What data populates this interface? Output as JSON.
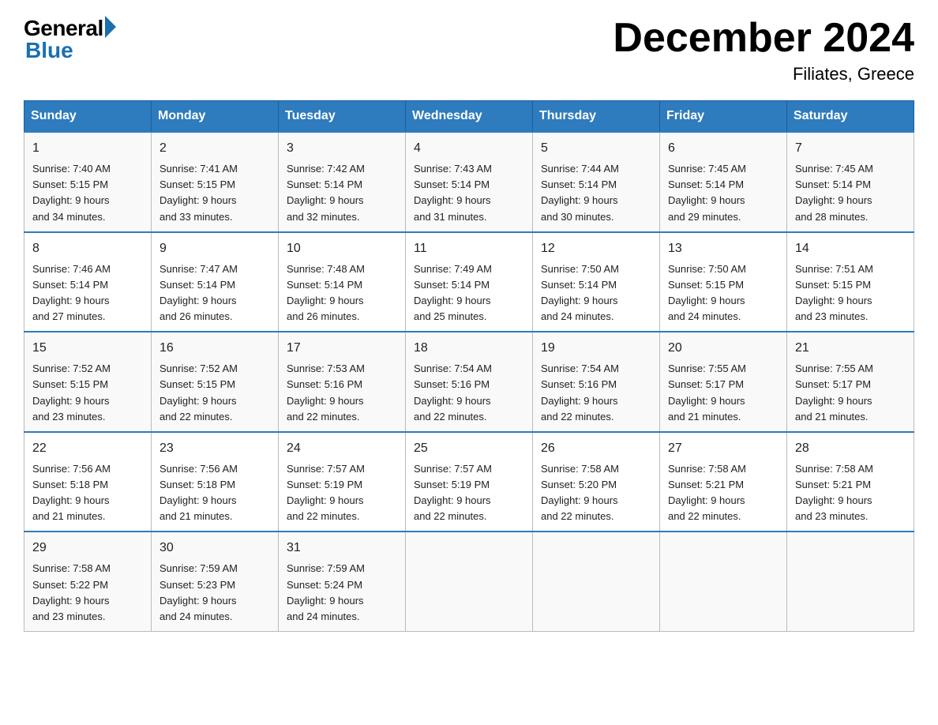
{
  "header": {
    "logo_general": "General",
    "logo_blue": "Blue",
    "title": "December 2024",
    "subtitle": "Filiates, Greece"
  },
  "days_of_week": [
    "Sunday",
    "Monday",
    "Tuesday",
    "Wednesday",
    "Thursday",
    "Friday",
    "Saturday"
  ],
  "weeks": [
    {
      "days": [
        {
          "num": "1",
          "sunrise": "7:40 AM",
          "sunset": "5:15 PM",
          "daylight": "9 hours and 34 minutes."
        },
        {
          "num": "2",
          "sunrise": "7:41 AM",
          "sunset": "5:15 PM",
          "daylight": "9 hours and 33 minutes."
        },
        {
          "num": "3",
          "sunrise": "7:42 AM",
          "sunset": "5:14 PM",
          "daylight": "9 hours and 32 minutes."
        },
        {
          "num": "4",
          "sunrise": "7:43 AM",
          "sunset": "5:14 PM",
          "daylight": "9 hours and 31 minutes."
        },
        {
          "num": "5",
          "sunrise": "7:44 AM",
          "sunset": "5:14 PM",
          "daylight": "9 hours and 30 minutes."
        },
        {
          "num": "6",
          "sunrise": "7:45 AM",
          "sunset": "5:14 PM",
          "daylight": "9 hours and 29 minutes."
        },
        {
          "num": "7",
          "sunrise": "7:45 AM",
          "sunset": "5:14 PM",
          "daylight": "9 hours and 28 minutes."
        }
      ]
    },
    {
      "days": [
        {
          "num": "8",
          "sunrise": "7:46 AM",
          "sunset": "5:14 PM",
          "daylight": "9 hours and 27 minutes."
        },
        {
          "num": "9",
          "sunrise": "7:47 AM",
          "sunset": "5:14 PM",
          "daylight": "9 hours and 26 minutes."
        },
        {
          "num": "10",
          "sunrise": "7:48 AM",
          "sunset": "5:14 PM",
          "daylight": "9 hours and 26 minutes."
        },
        {
          "num": "11",
          "sunrise": "7:49 AM",
          "sunset": "5:14 PM",
          "daylight": "9 hours and 25 minutes."
        },
        {
          "num": "12",
          "sunrise": "7:50 AM",
          "sunset": "5:14 PM",
          "daylight": "9 hours and 24 minutes."
        },
        {
          "num": "13",
          "sunrise": "7:50 AM",
          "sunset": "5:15 PM",
          "daylight": "9 hours and 24 minutes."
        },
        {
          "num": "14",
          "sunrise": "7:51 AM",
          "sunset": "5:15 PM",
          "daylight": "9 hours and 23 minutes."
        }
      ]
    },
    {
      "days": [
        {
          "num": "15",
          "sunrise": "7:52 AM",
          "sunset": "5:15 PM",
          "daylight": "9 hours and 23 minutes."
        },
        {
          "num": "16",
          "sunrise": "7:52 AM",
          "sunset": "5:15 PM",
          "daylight": "9 hours and 22 minutes."
        },
        {
          "num": "17",
          "sunrise": "7:53 AM",
          "sunset": "5:16 PM",
          "daylight": "9 hours and 22 minutes."
        },
        {
          "num": "18",
          "sunrise": "7:54 AM",
          "sunset": "5:16 PM",
          "daylight": "9 hours and 22 minutes."
        },
        {
          "num": "19",
          "sunrise": "7:54 AM",
          "sunset": "5:16 PM",
          "daylight": "9 hours and 22 minutes."
        },
        {
          "num": "20",
          "sunrise": "7:55 AM",
          "sunset": "5:17 PM",
          "daylight": "9 hours and 21 minutes."
        },
        {
          "num": "21",
          "sunrise": "7:55 AM",
          "sunset": "5:17 PM",
          "daylight": "9 hours and 21 minutes."
        }
      ]
    },
    {
      "days": [
        {
          "num": "22",
          "sunrise": "7:56 AM",
          "sunset": "5:18 PM",
          "daylight": "9 hours and 21 minutes."
        },
        {
          "num": "23",
          "sunrise": "7:56 AM",
          "sunset": "5:18 PM",
          "daylight": "9 hours and 21 minutes."
        },
        {
          "num": "24",
          "sunrise": "7:57 AM",
          "sunset": "5:19 PM",
          "daylight": "9 hours and 22 minutes."
        },
        {
          "num": "25",
          "sunrise": "7:57 AM",
          "sunset": "5:19 PM",
          "daylight": "9 hours and 22 minutes."
        },
        {
          "num": "26",
          "sunrise": "7:58 AM",
          "sunset": "5:20 PM",
          "daylight": "9 hours and 22 minutes."
        },
        {
          "num": "27",
          "sunrise": "7:58 AM",
          "sunset": "5:21 PM",
          "daylight": "9 hours and 22 minutes."
        },
        {
          "num": "28",
          "sunrise": "7:58 AM",
          "sunset": "5:21 PM",
          "daylight": "9 hours and 23 minutes."
        }
      ]
    },
    {
      "days": [
        {
          "num": "29",
          "sunrise": "7:58 AM",
          "sunset": "5:22 PM",
          "daylight": "9 hours and 23 minutes."
        },
        {
          "num": "30",
          "sunrise": "7:59 AM",
          "sunset": "5:23 PM",
          "daylight": "9 hours and 24 minutes."
        },
        {
          "num": "31",
          "sunrise": "7:59 AM",
          "sunset": "5:24 PM",
          "daylight": "9 hours and 24 minutes."
        },
        null,
        null,
        null,
        null
      ]
    }
  ],
  "labels": {
    "sunrise": "Sunrise:",
    "sunset": "Sunset:",
    "daylight": "Daylight:"
  }
}
